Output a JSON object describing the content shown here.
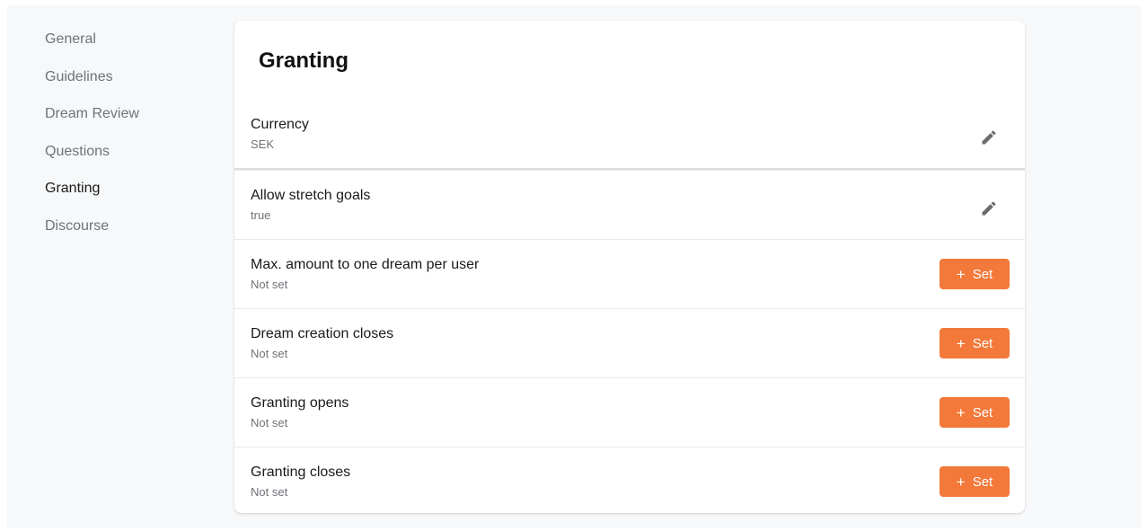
{
  "sidebar": {
    "items": [
      {
        "label": "General",
        "active": false
      },
      {
        "label": "Guidelines",
        "active": false
      },
      {
        "label": "Dream Review",
        "active": false
      },
      {
        "label": "Questions",
        "active": false
      },
      {
        "label": "Granting",
        "active": true
      },
      {
        "label": "Discourse",
        "active": false
      }
    ]
  },
  "card": {
    "title": "Granting",
    "rows": [
      {
        "label": "Currency",
        "value": "SEK",
        "action": "edit",
        "action_icon": "pencil-icon"
      },
      {
        "label": "Allow stretch goals",
        "value": "true",
        "action": "edit",
        "action_icon": "pencil-icon"
      },
      {
        "label": "Max. amount to one dream per user",
        "value": "Not set",
        "action": "set",
        "action_label": "Set",
        "action_prefix": "+"
      },
      {
        "label": "Dream creation closes",
        "value": "Not set",
        "action": "set",
        "action_label": "Set",
        "action_prefix": "+"
      },
      {
        "label": "Granting opens",
        "value": "Not set",
        "action": "set",
        "action_label": "Set",
        "action_prefix": "+"
      },
      {
        "label": "Granting closes",
        "value": "Not set",
        "action": "set",
        "action_label": "Set",
        "action_prefix": "+"
      }
    ]
  },
  "colors": {
    "accent": "#f2793a",
    "muted_text": "#6f7277",
    "background": "#f7f8f9"
  }
}
